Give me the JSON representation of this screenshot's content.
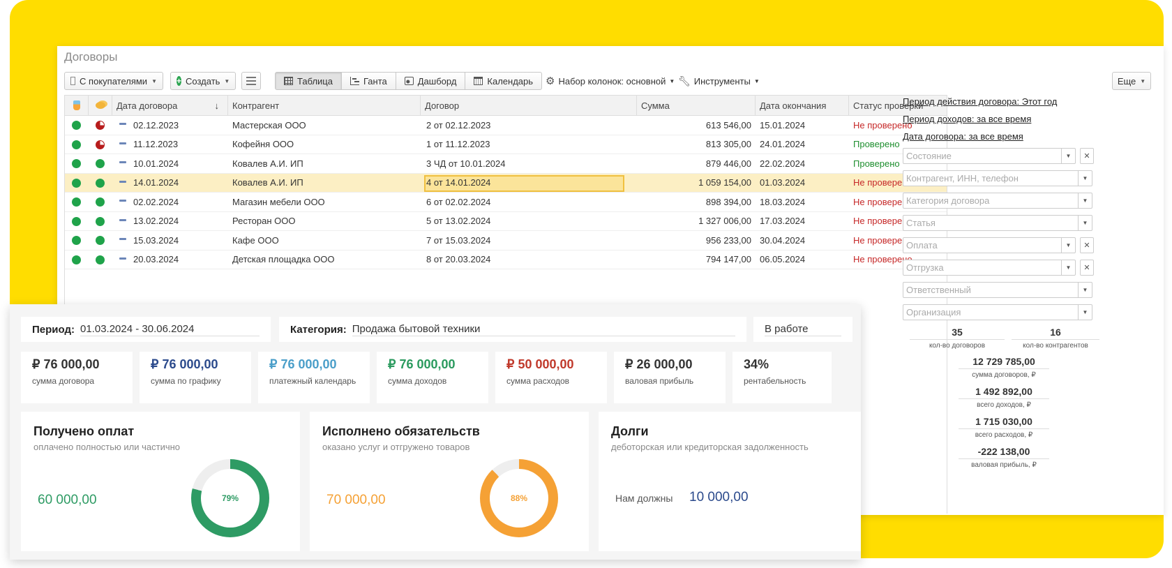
{
  "window": {
    "title": "Договоры"
  },
  "toolbar": {
    "buyers_label": "С покупателями",
    "create_label": "Создать",
    "views": [
      "Таблица",
      "Ганта",
      "Дашборд",
      "Календарь"
    ],
    "columns_label": "Набор колонок: основной",
    "tools_label": "Инструменты",
    "more_label": "Еще"
  },
  "table": {
    "headers": {
      "date": "Дата договора",
      "sort": "↓",
      "counterparty": "Контрагент",
      "contract": "Договор",
      "amount": "Сумма",
      "end_date": "Дата окончания",
      "status": "Статус проверки"
    },
    "rows": [
      {
        "date": "02.12.2023",
        "counterparty": "Мастерская ООО",
        "contract": "2 от 02.12.2023",
        "amount": "613 546,00",
        "end_date": "15.01.2024",
        "status": "Не проверено",
        "ok": false,
        "pie": true
      },
      {
        "date": "11.12.2023",
        "counterparty": "Кофейня ООО",
        "contract": "1 от 11.12.2023",
        "amount": "813 305,00",
        "end_date": "24.01.2024",
        "status": "Проверено",
        "ok": true,
        "pie": true
      },
      {
        "date": "10.01.2024",
        "counterparty": "Ковалев А.И. ИП",
        "contract": "3 ЧД от 10.01.2024",
        "amount": "879 446,00",
        "end_date": "22.02.2024",
        "status": "Проверено",
        "ok": true,
        "pie": false
      },
      {
        "date": "14.01.2024",
        "counterparty": "Ковалев А.И. ИП",
        "contract": "4 от 14.01.2024",
        "amount": "1 059 154,00",
        "end_date": "01.03.2024",
        "status": "Не проверено",
        "ok": false,
        "pie": false
      },
      {
        "date": "02.02.2024",
        "counterparty": "Магазин мебели ООО",
        "contract": "6 от 02.02.2024",
        "amount": "898 394,00",
        "end_date": "18.03.2024",
        "status": "Не проверено",
        "ok": false,
        "pie": false
      },
      {
        "date": "13.02.2024",
        "counterparty": "Ресторан ООО",
        "contract": "5 от 13.02.2024",
        "amount": "1 327 006,00",
        "end_date": "17.03.2024",
        "status": "Не проверено",
        "ok": false,
        "pie": false
      },
      {
        "date": "15.03.2024",
        "counterparty": "Кафе ООО",
        "contract": "7 от 15.03.2024",
        "amount": "956 233,00",
        "end_date": "30.04.2024",
        "status": "Не проверено",
        "ok": false,
        "pie": false
      },
      {
        "date": "20.03.2024",
        "counterparty": "Детская площадка ООО",
        "contract": "8 от 20.03.2024",
        "amount": "794 147,00",
        "end_date": "06.05.2024",
        "status": "Не проверено",
        "ok": false,
        "pie": false
      }
    ]
  },
  "sidebar": {
    "links": [
      "Период действия договора: Этот год",
      "Период доходов: за все время",
      "Дата договора: за все время"
    ],
    "filters": [
      "Состояние",
      "Контрагент, ИНН, телефон",
      "Категория договора",
      "Статья",
      "Оплата",
      "Отгрузка",
      "Ответственный",
      "Организация"
    ],
    "stats": {
      "contracts_count": "35",
      "contracts_count_label": "кол-во договоров",
      "counterparties_count": "16",
      "counterparties_count_label": "кол-во контрагентов",
      "sum_contracts": "12 729 785,00",
      "sum_contracts_label": "сумма договоров, ₽",
      "total_income": "1 492 892,00",
      "total_income_label": "всего доходов, ₽",
      "total_expense": "1 715 030,00",
      "total_expense_label": "всего расходов, ₽",
      "gross_profit": "-222 138,00",
      "gross_profit_label": "валовая прибыль, ₽"
    }
  },
  "dashboard": {
    "period_label": "Период:",
    "period_value": "01.03.2024 - 30.06.2024",
    "category_label": "Категория:",
    "category_value": "Продажа бытовой техники",
    "status_value": "В работе",
    "kpis": [
      {
        "value": "₽ 76 000,00",
        "label": "сумма договора",
        "color": "#333333"
      },
      {
        "value": "₽ 76 000,00",
        "label": "сумма по графику",
        "color": "#2b4a8c"
      },
      {
        "value": "₽ 76 000,00",
        "label": "платежный календарь",
        "color": "#4a9ec9"
      },
      {
        "value": "₽ 76 000,00",
        "label": "сумма доходов",
        "color": "#2a9a5e"
      },
      {
        "value": "₽ 50 000,00",
        "label": "сумма расходов",
        "color": "#c0392b"
      },
      {
        "value": "₽ 26 000,00",
        "label": "валовая прибыль",
        "color": "#333333"
      },
      {
        "value": "34%",
        "label": "рентабельность",
        "color": "#333333"
      }
    ],
    "paid": {
      "title": "Получено оплат",
      "subtitle": "оплачено полностью или частично",
      "amount": "60 000,00",
      "percent_label": "79%",
      "percent": 79,
      "color": "#2e9b64"
    },
    "fulfilled": {
      "title": "Исполнено обязательств",
      "subtitle": "оказано услуг и отгружено товаров",
      "amount": "70 000,00",
      "percent_label": "88%",
      "percent": 88,
      "color": "#f5a135"
    },
    "debts": {
      "title": "Долги",
      "subtitle": "деботорская или кредиторская задолженность",
      "owed_label": "Нам должны",
      "owed_value": "10 000,00",
      "color": "#2b4a8c"
    }
  }
}
